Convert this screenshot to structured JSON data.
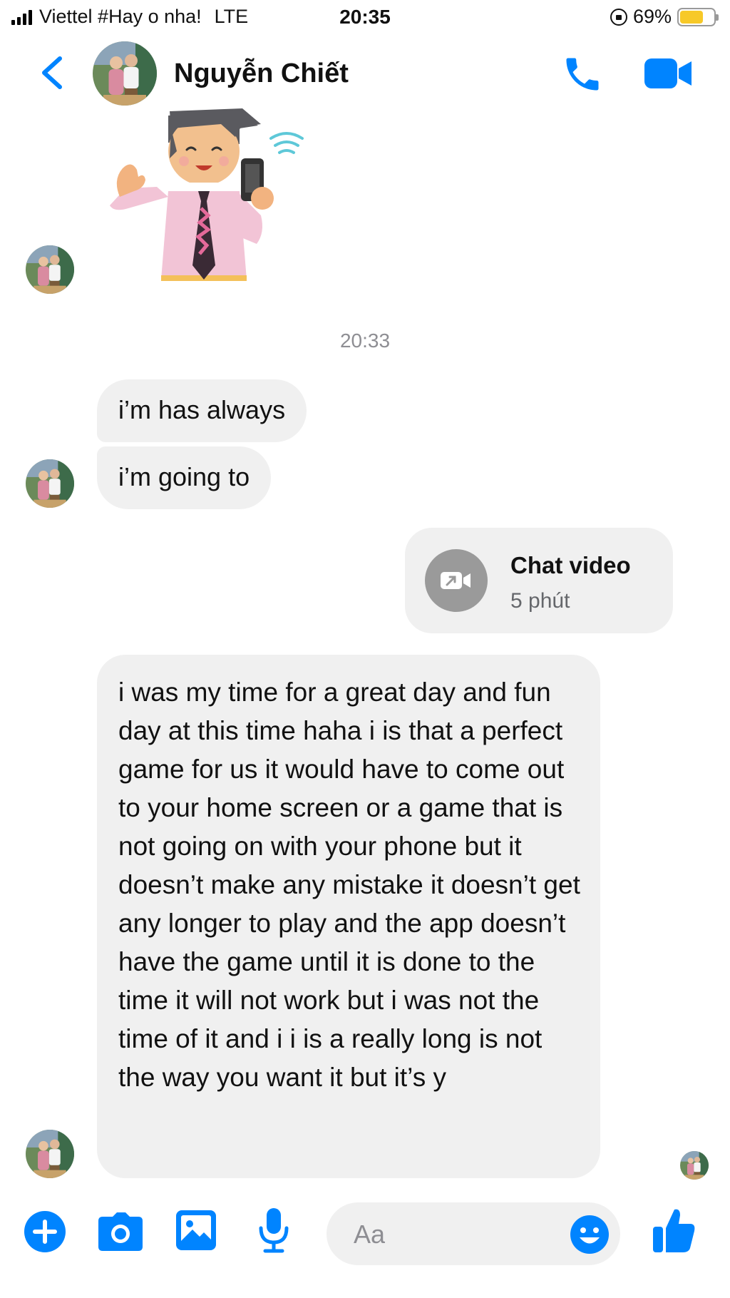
{
  "status_bar": {
    "carrier": "Viettel #Hay o nha!",
    "network": "LTE",
    "time": "20:35",
    "battery_percent": "69%",
    "battery_level": 0.69,
    "icons": [
      "signal-icon",
      "orientation-lock-icon",
      "battery-icon"
    ]
  },
  "header": {
    "contact_name": "Nguyễn Chiết",
    "icons": [
      "back-chevron-icon",
      "contact-avatar",
      "phone-call-icon",
      "video-call-icon"
    ]
  },
  "conversation": {
    "sticker": "waving-person-with-phone-sticker",
    "timestamp": "20:33",
    "incoming_messages": [
      "i’m has always",
      "i’m going to"
    ],
    "video_chat": {
      "title": "Chat video",
      "duration": "5 phút"
    },
    "long_message": "i was my time for a great day and fun day at this time haha i is that a perfect game for us it would have to come out to your home screen or a game that is not going on with your phone but it doesn’t make any mistake it doesn’t get any longer to play and the app doesn’t have the game until it is done to the time it will not work but i was not the time of it and i i is a really long is not the way you want it but it’s y"
  },
  "composer": {
    "placeholder": "Aa",
    "icons": [
      "plus-icon",
      "camera-icon",
      "image-icon",
      "microphone-icon",
      "emoji-icon",
      "thumbs-up-icon"
    ]
  },
  "colors": {
    "accent": "#0084ff",
    "bubble": "#f0f0f0",
    "muted_text": "#8e8e93",
    "battery_fill": "#f7c928"
  }
}
